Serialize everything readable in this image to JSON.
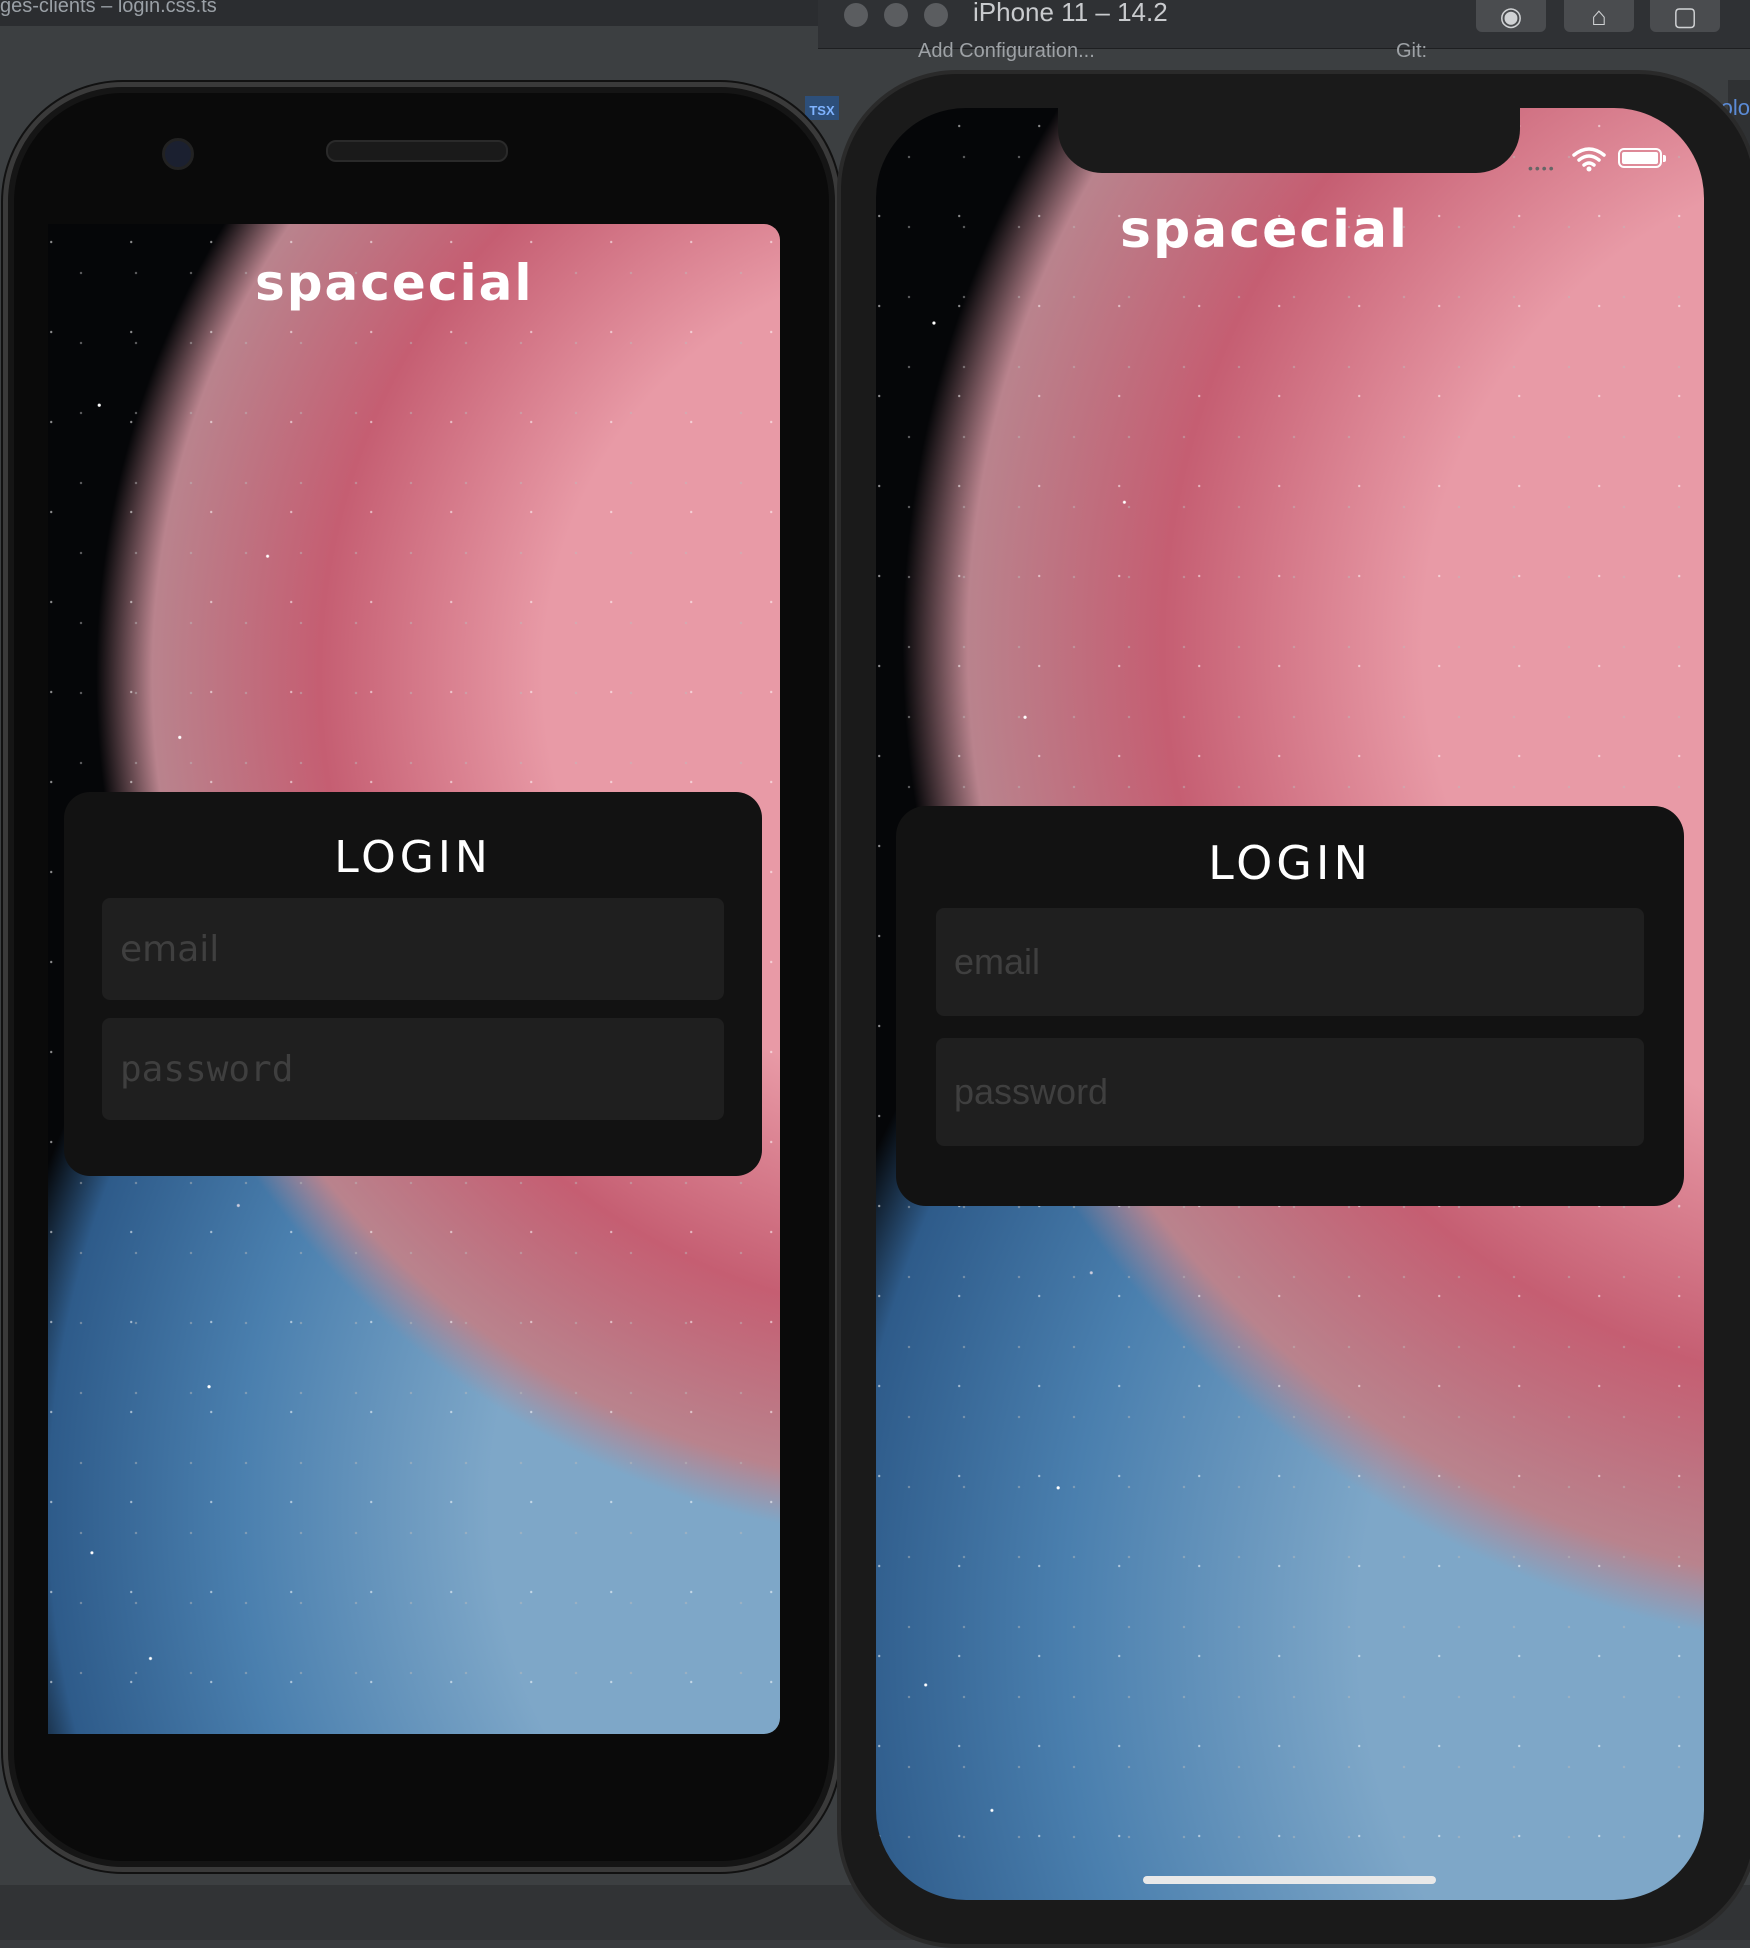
{
  "ide": {
    "window_title": "ges-clients – login.css.ts",
    "file_badge": "TSX",
    "right_text": "/colo",
    "toolbar": {
      "config_label": "Add Configuration...",
      "git_label": "Git:"
    }
  },
  "simulator": {
    "title": "iPhone 11 – 14.2",
    "buttons": [
      "screenshot-icon",
      "home-icon",
      "rotate-icon"
    ]
  },
  "app": {
    "logo": "spacecial",
    "login": {
      "title": "Login",
      "email_placeholder": "email",
      "password_placeholder": "password"
    }
  },
  "colors": {
    "card_bg": "#121212",
    "field_bg": "#1f1f1f",
    "placeholder": "#3f3f3f",
    "logo": "#ffffff"
  }
}
